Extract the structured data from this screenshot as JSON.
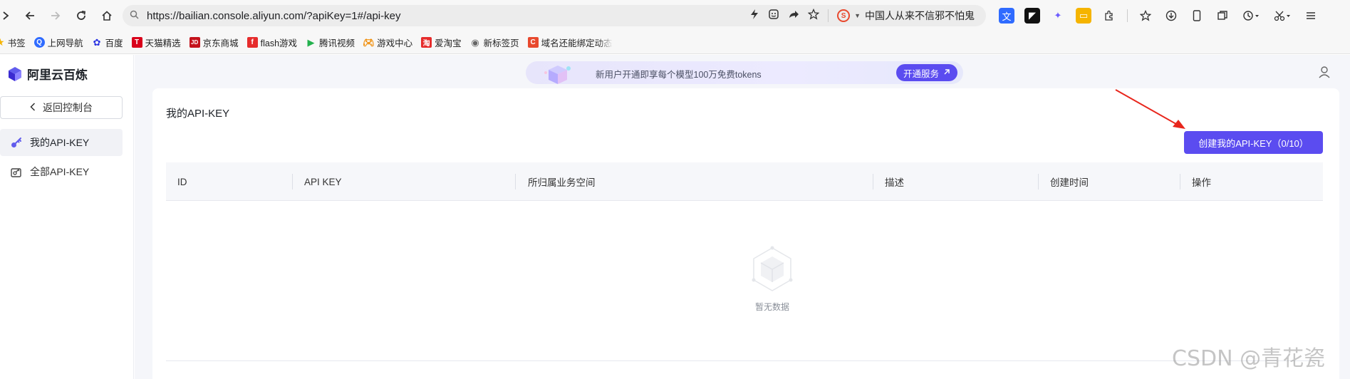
{
  "browser": {
    "url": "https://bailian.console.aliyun.com/?apiKey=1#/api-key",
    "search_engine_text": "中国人从来不信邪不怕鬼",
    "bookmarks": [
      {
        "label": "书签",
        "icon": "star-icon",
        "color": "#f5b400"
      },
      {
        "label": "上网导航",
        "icon": "nav-icon",
        "color": "#2f6bff"
      },
      {
        "label": "百度",
        "icon": "baidu-icon",
        "color": "#2932e1"
      },
      {
        "label": "天猫精选",
        "icon": "tmall-icon",
        "color": "#d9001b"
      },
      {
        "label": "京东商城",
        "icon": "jd-icon",
        "color": "#c4121b"
      },
      {
        "label": "flash游戏",
        "icon": "flash-icon",
        "color": "#e62c2c"
      },
      {
        "label": "腾讯视频",
        "icon": "tencent-video-icon",
        "color": "#23b14d"
      },
      {
        "label": "游戏中心",
        "icon": "gamepad-icon",
        "color": "#f08a00"
      },
      {
        "label": "爱淘宝",
        "icon": "taobao-icon",
        "color": "#e62c2c"
      },
      {
        "label": "新标签页",
        "icon": "newtab-icon",
        "color": "#666666"
      },
      {
        "label": "域名还能绑定动态",
        "icon": "domain-icon",
        "color": "#e8492e"
      }
    ]
  },
  "app": {
    "logo_text": "阿里云百炼",
    "back_label": "返回控制台",
    "nav": [
      {
        "label": "我的API-KEY",
        "icon": "key-icon",
        "active": true
      },
      {
        "label": "全部API-KEY",
        "icon": "key-list-icon",
        "active": false
      }
    ],
    "banner_text": "新用户开通即享每个模型100万免费tokens",
    "banner_button": "开通服务",
    "page_title": "我的API-KEY",
    "create_button": "创建我的API-KEY（0/10）",
    "table_headers": [
      "ID",
      "API KEY",
      "所归属业务空间",
      "描述",
      "创建时间",
      "操作"
    ],
    "empty_text": "暂无数据",
    "accent_color": "#5b4cf0"
  },
  "watermark": "CSDN @青花瓷"
}
